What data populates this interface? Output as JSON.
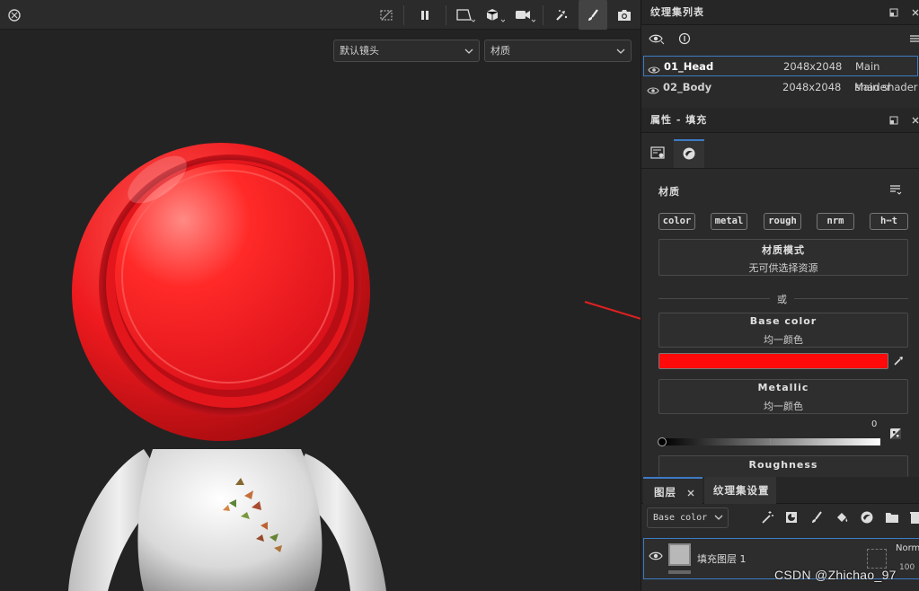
{
  "viewport": {
    "camera_select": "默认镜头",
    "material_select": "材质",
    "toolbar_icons": [
      "clock-icon",
      "hide-icon",
      "pause-icon",
      "projection-icon",
      "cube-icon",
      "camera-icon",
      "paint-effects-icon",
      "brush-icon",
      "screenshot-icon"
    ]
  },
  "texture_set_list": {
    "title": "纹理集列表",
    "rows": [
      {
        "name": "01_Head",
        "resolution": "2048x2048",
        "shader": "Main shader",
        "selected": true
      },
      {
        "name": "02_Body",
        "resolution": "2048x2048",
        "shader": "Main shader",
        "selected": false
      }
    ]
  },
  "properties": {
    "title": "属性 - 填充",
    "section_label": "材质",
    "channels": [
      "color",
      "metal",
      "rough",
      "nrm",
      "h⋯t"
    ],
    "material_mode_title": "材质模式",
    "material_mode_sub": "无可供选择资源",
    "or_label": "或",
    "base_color_title": "Base color",
    "base_color_sub": "均一颜色",
    "base_color_hex": "#ff0a0a",
    "metallic_title": "Metallic",
    "metallic_sub": "均一颜色",
    "metallic_value": "0",
    "metallic_fraction": 0,
    "roughness_title": "Roughness"
  },
  "layers": {
    "tab_layers": "图层",
    "tab_texture_settings": "纹理集设置",
    "channel_select": "Base color",
    "layer_name": "填充图层 1",
    "blend_mode": "Norm",
    "opacity": "100"
  },
  "watermark": "CSDN @Zhichao_97",
  "colors": {
    "accent": "#3d7bc4",
    "head_red": "#e8141a",
    "arrow_red": "#e02020"
  }
}
